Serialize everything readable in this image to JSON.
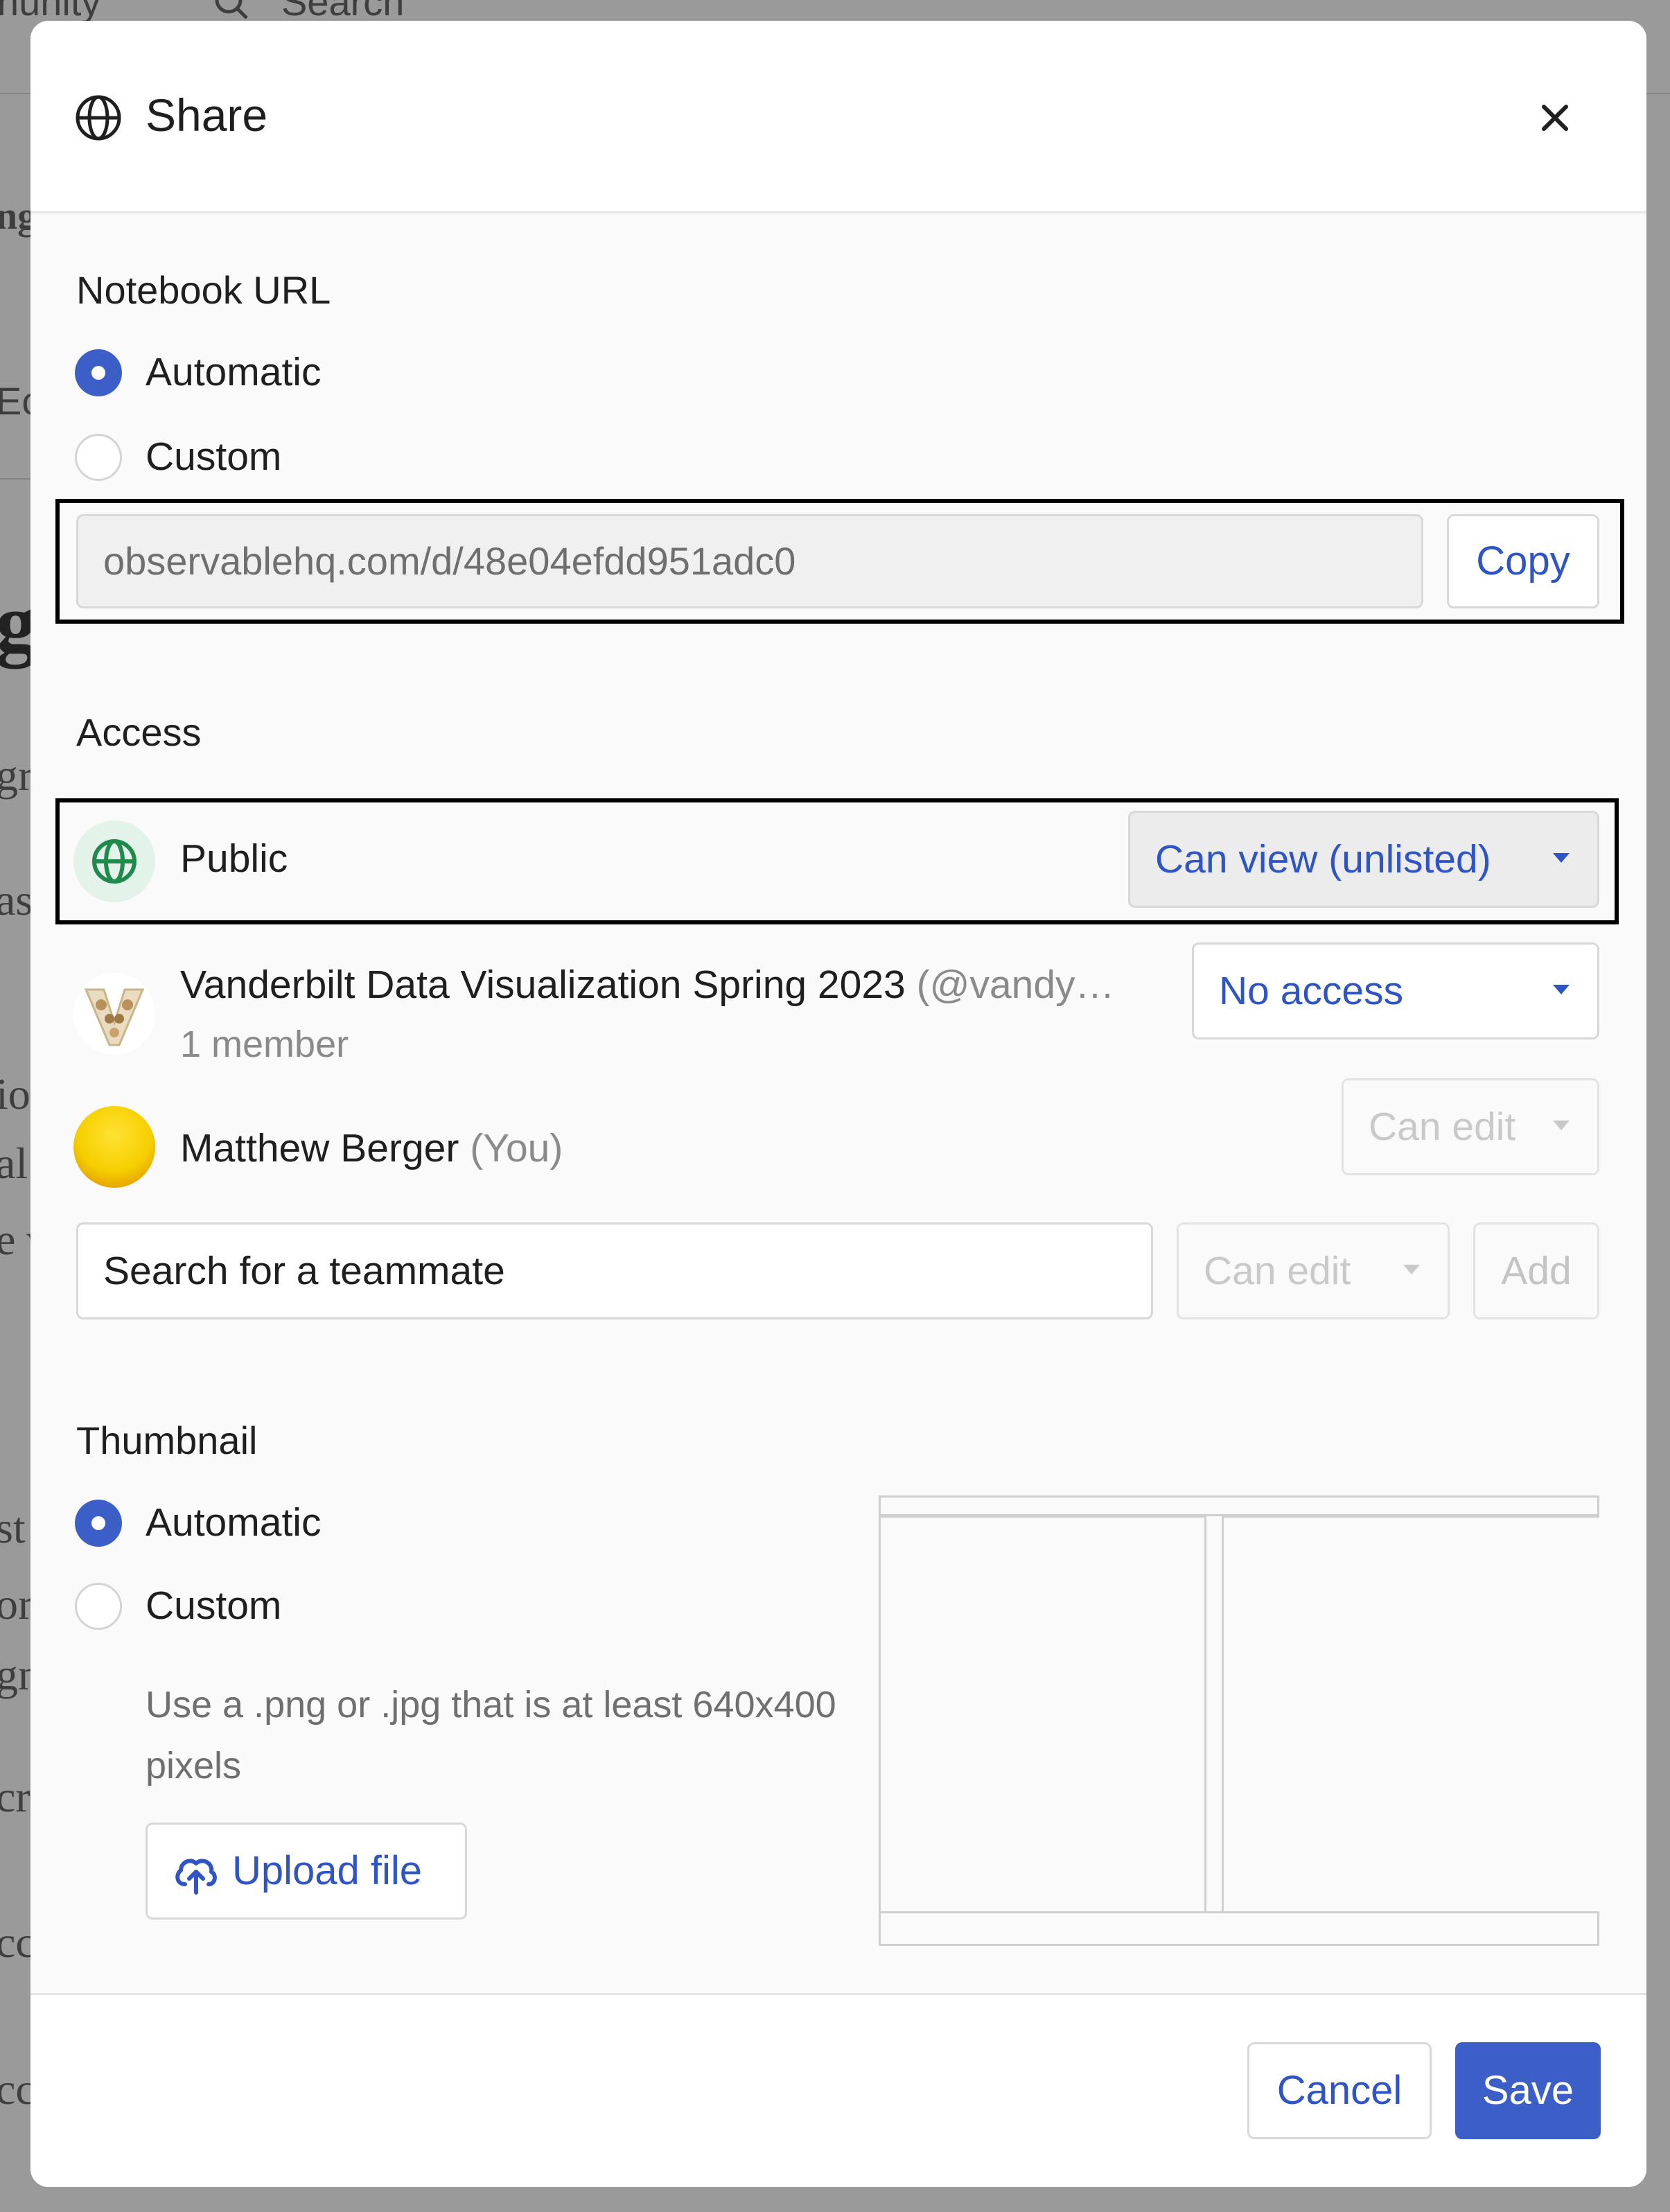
{
  "background": {
    "nav_fragment": "nunity",
    "search_label": "Search",
    "fragments": [
      "ng",
      "Ec",
      "ig",
      "gr",
      "as",
      "io",
      "al",
      "e v",
      "st",
      "or",
      "gn",
      "cr",
      "cc",
      "cc"
    ]
  },
  "dialog": {
    "title": "Share",
    "close_icon": "close-icon",
    "notebook_url": {
      "label": "Notebook URL",
      "options": [
        {
          "label": "Automatic",
          "selected": true
        },
        {
          "label": "Custom",
          "selected": false
        }
      ],
      "url_value": "observablehq.com/d/48e04efdd951adc0",
      "copy_label": "Copy"
    },
    "access": {
      "label": "Access",
      "public": {
        "name": "Public",
        "permission": "Can view (unlisted)"
      },
      "team": {
        "name": "Vanderbilt Data Visualization Spring 2023",
        "handle": "(@vandy…",
        "members": "1 member",
        "permission": "No access"
      },
      "me": {
        "name": "Matthew Berger",
        "suffix": "(You)",
        "permission": "Can edit"
      },
      "search_placeholder": "Search for a teammate",
      "new_permission": "Can edit",
      "add_label": "Add"
    },
    "thumbnail": {
      "label": "Thumbnail",
      "options": [
        {
          "label": "Automatic",
          "selected": true
        },
        {
          "label": "Custom",
          "selected": false
        }
      ],
      "hint": "Use a .png or .jpg that is at least 640x400 pixels",
      "upload_label": "Upload file"
    },
    "footer": {
      "cancel_label": "Cancel",
      "save_label": "Save"
    }
  },
  "colors": {
    "accent": "#3b5fc7",
    "link": "#2f54c5",
    "public_icon": "#1f8a4c"
  }
}
